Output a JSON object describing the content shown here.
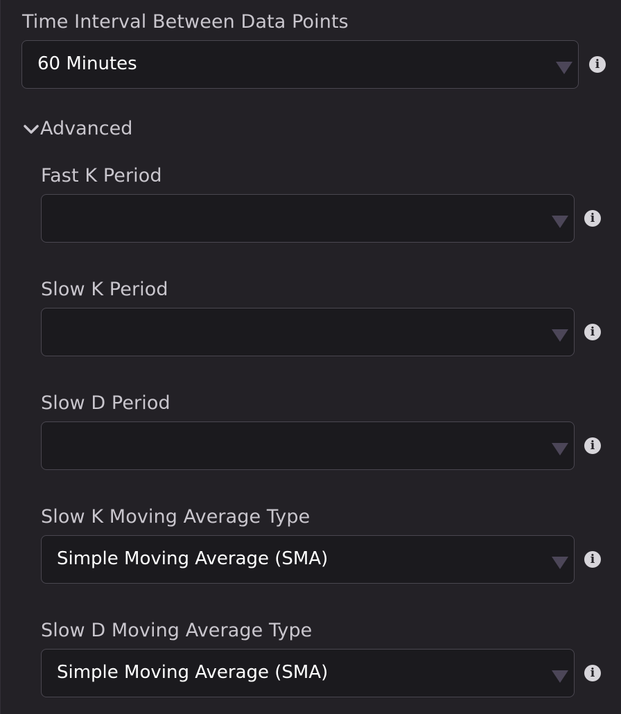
{
  "interval": {
    "label": "Time Interval Between Data Points",
    "value": "60 Minutes"
  },
  "advanced": {
    "label": "Advanced",
    "expanded": true,
    "fields": [
      {
        "label": "Fast K Period",
        "value": ""
      },
      {
        "label": "Slow K Period",
        "value": ""
      },
      {
        "label": "Slow D Period",
        "value": ""
      },
      {
        "label": "Slow K Moving Average Type",
        "value": "Simple Moving Average (SMA)"
      },
      {
        "label": "Slow D Moving Average Type",
        "value": "Simple Moving Average (SMA)"
      }
    ]
  },
  "info_icon_glyph": "i",
  "icons": {
    "info": "info-icon",
    "caret": "caret-down-icon",
    "chevron": "chevron-down-icon"
  },
  "colors": {
    "background": "#232126",
    "field_background": "#1b1a1e",
    "field_border": "#4a4750",
    "label_text": "#c9c6cd",
    "value_text": "#ffffff",
    "caret": "#4c4658",
    "info_icon": "#d7d5da"
  }
}
